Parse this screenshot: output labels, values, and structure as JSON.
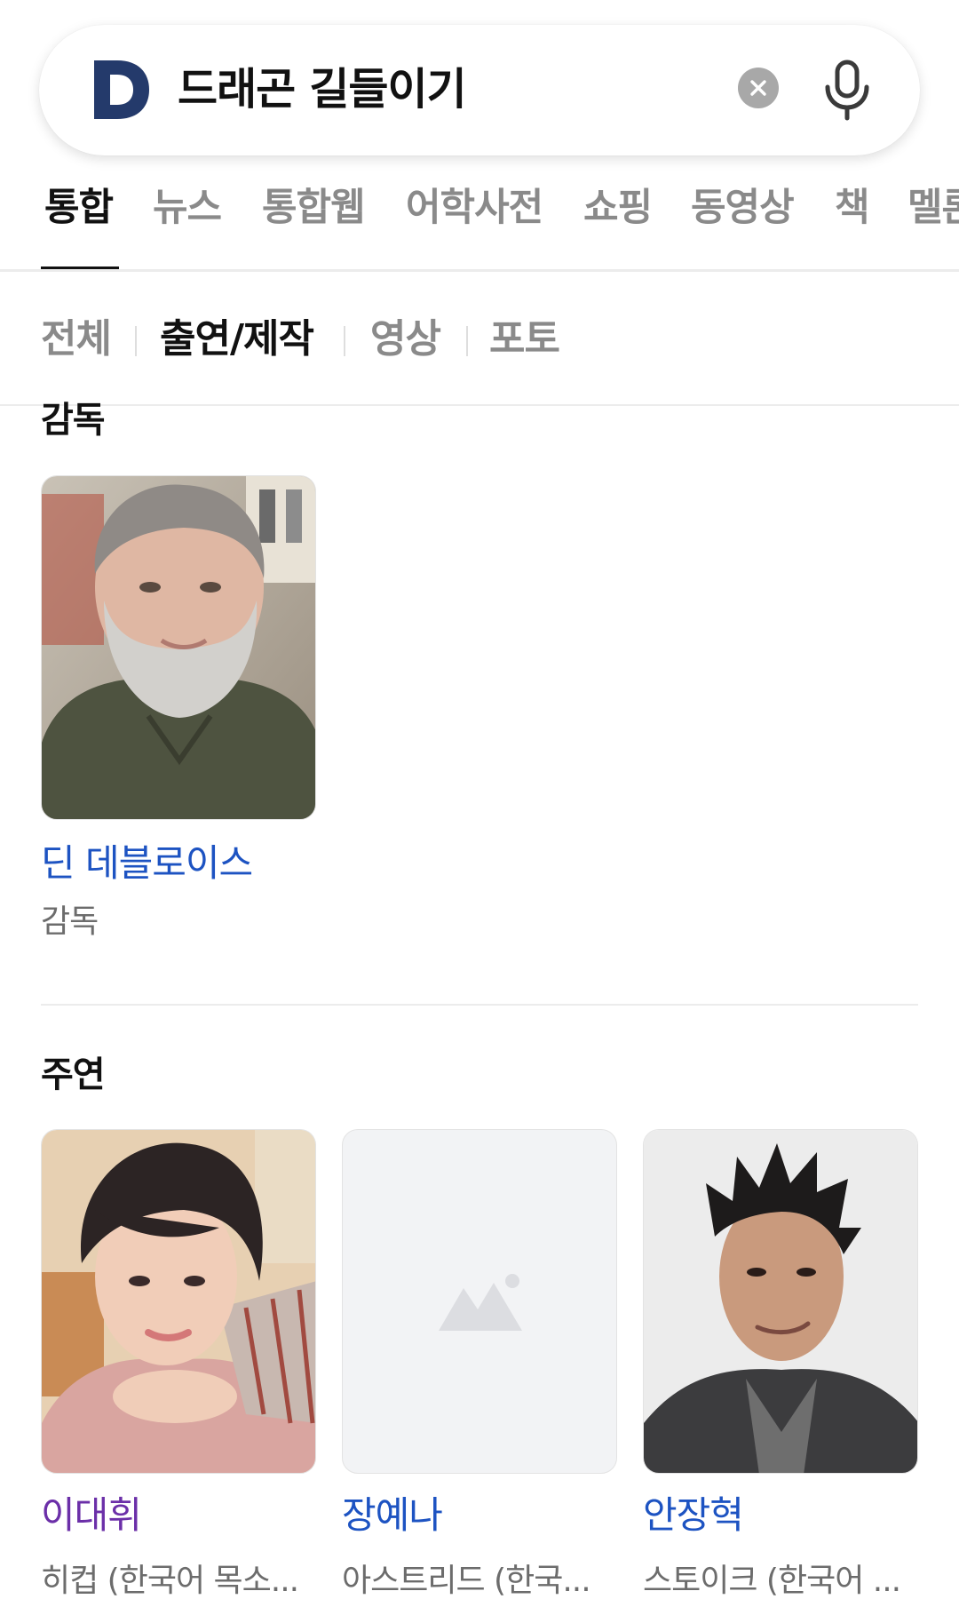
{
  "search": {
    "query": "드래곤 길들이기",
    "logo_letter": "D"
  },
  "tabs": [
    {
      "label": "통합",
      "active": true
    },
    {
      "label": "뉴스"
    },
    {
      "label": "통합웹"
    },
    {
      "label": "어학사전"
    },
    {
      "label": "쇼핑"
    },
    {
      "label": "동영상"
    },
    {
      "label": "책"
    },
    {
      "label": "멜론"
    }
  ],
  "subtabs": [
    {
      "label": "전체"
    },
    {
      "label": "출연/제작",
      "active": true
    },
    {
      "label": "영상"
    },
    {
      "label": "포토"
    }
  ],
  "director_section": {
    "title": "감독",
    "people": [
      {
        "name": "딘 데블로이스",
        "role": "감독"
      }
    ]
  },
  "cast_section": {
    "title": "주연",
    "people": [
      {
        "name": "이대휘",
        "role": "히컵 (한국어 목소..."
      },
      {
        "name": "장예나",
        "role": "아스트리드 (한국..."
      },
      {
        "name": "안장혁",
        "role": "스토이크 (한국어 ..."
      }
    ]
  },
  "colors": {
    "link": "#1d53c2",
    "visited_link": "#6b2fa8",
    "logo": "#243a6b"
  }
}
